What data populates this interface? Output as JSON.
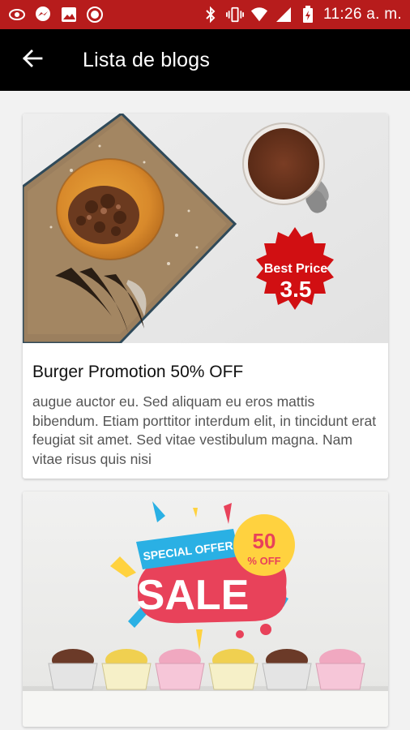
{
  "status_bar": {
    "time": "11:26 a. m.",
    "left_icons": [
      "sun-icon",
      "messenger-icon",
      "image-icon",
      "record-icon"
    ],
    "right_icons": [
      "bluetooth-icon",
      "vibrate-icon",
      "wifi-icon",
      "signal-icon",
      "battery-icon"
    ]
  },
  "app_bar": {
    "title": "Lista de blogs",
    "back_icon": "arrow-back-icon"
  },
  "blogs": [
    {
      "title": "Burger Promotion 50% OFF",
      "description": "augue auctor eu. Sed aliquam eu eros mattis bibendum. Etiam porttitor interdum elit, in tincidunt erat feugiat sit amet. Sed vitae vestibulum magna. Nam vitae risus quis nisi",
      "badge_line1": "Best Price",
      "badge_line2": "3.5"
    },
    {
      "banner_line1": "SPECIAL OFFER",
      "banner_line2": "SALE",
      "circle_line1": "50",
      "circle_line2": "% OFF"
    }
  ],
  "colors": {
    "status_bar": "#b71c1c",
    "app_bar": "#000000",
    "badge_red": "#d10f12",
    "sale_pink": "#e8425a",
    "offer_blue": "#2ab0e4",
    "offer_yellow": "#ffd23f"
  }
}
